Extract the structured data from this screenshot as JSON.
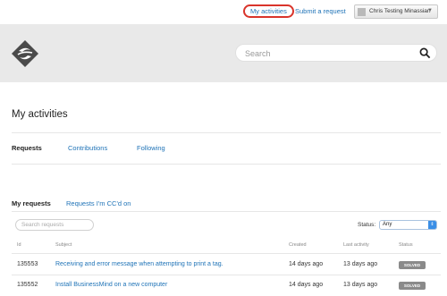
{
  "top_nav": {
    "my_activities": "My activities",
    "submit_request": "Submit a request",
    "user_name": "Chris Testing Minassian"
  },
  "banner": {
    "search_placeholder": "Search"
  },
  "page": {
    "title": "My activities"
  },
  "tabs": [
    {
      "label": "Requests",
      "active": true
    },
    {
      "label": "Contributions",
      "active": false
    },
    {
      "label": "Following",
      "active": false
    }
  ],
  "subtabs": [
    {
      "label": "My requests",
      "active": true
    },
    {
      "label": "Requests I'm CC'd on",
      "active": false
    }
  ],
  "filters": {
    "search_placeholder": "Search requests",
    "status_label": "Status:",
    "status_value": "Any"
  },
  "table": {
    "headers": [
      "Id",
      "Subject",
      "Created",
      "Last activity",
      "Status"
    ],
    "rows": [
      {
        "id": "135553",
        "subject": "Receiving and error message when attempting to print a tag.",
        "created": "14 days ago",
        "last_activity": "13 days ago",
        "status": "SOLVED"
      },
      {
        "id": "135552",
        "subject": "Install BusinessMind on a new computer",
        "created": "14 days ago",
        "last_activity": "13 days ago",
        "status": "SOLVED"
      }
    ]
  },
  "colors": {
    "link": "#1f73b7",
    "highlight_ring": "#d9342b",
    "banner_bg": "#e9e9e9",
    "badge_bg": "#8a8a8a"
  },
  "icons": {
    "logo": "logo-icon",
    "search": "search-icon",
    "caret": "caret-down-icon",
    "select": "select-arrow-icon"
  }
}
